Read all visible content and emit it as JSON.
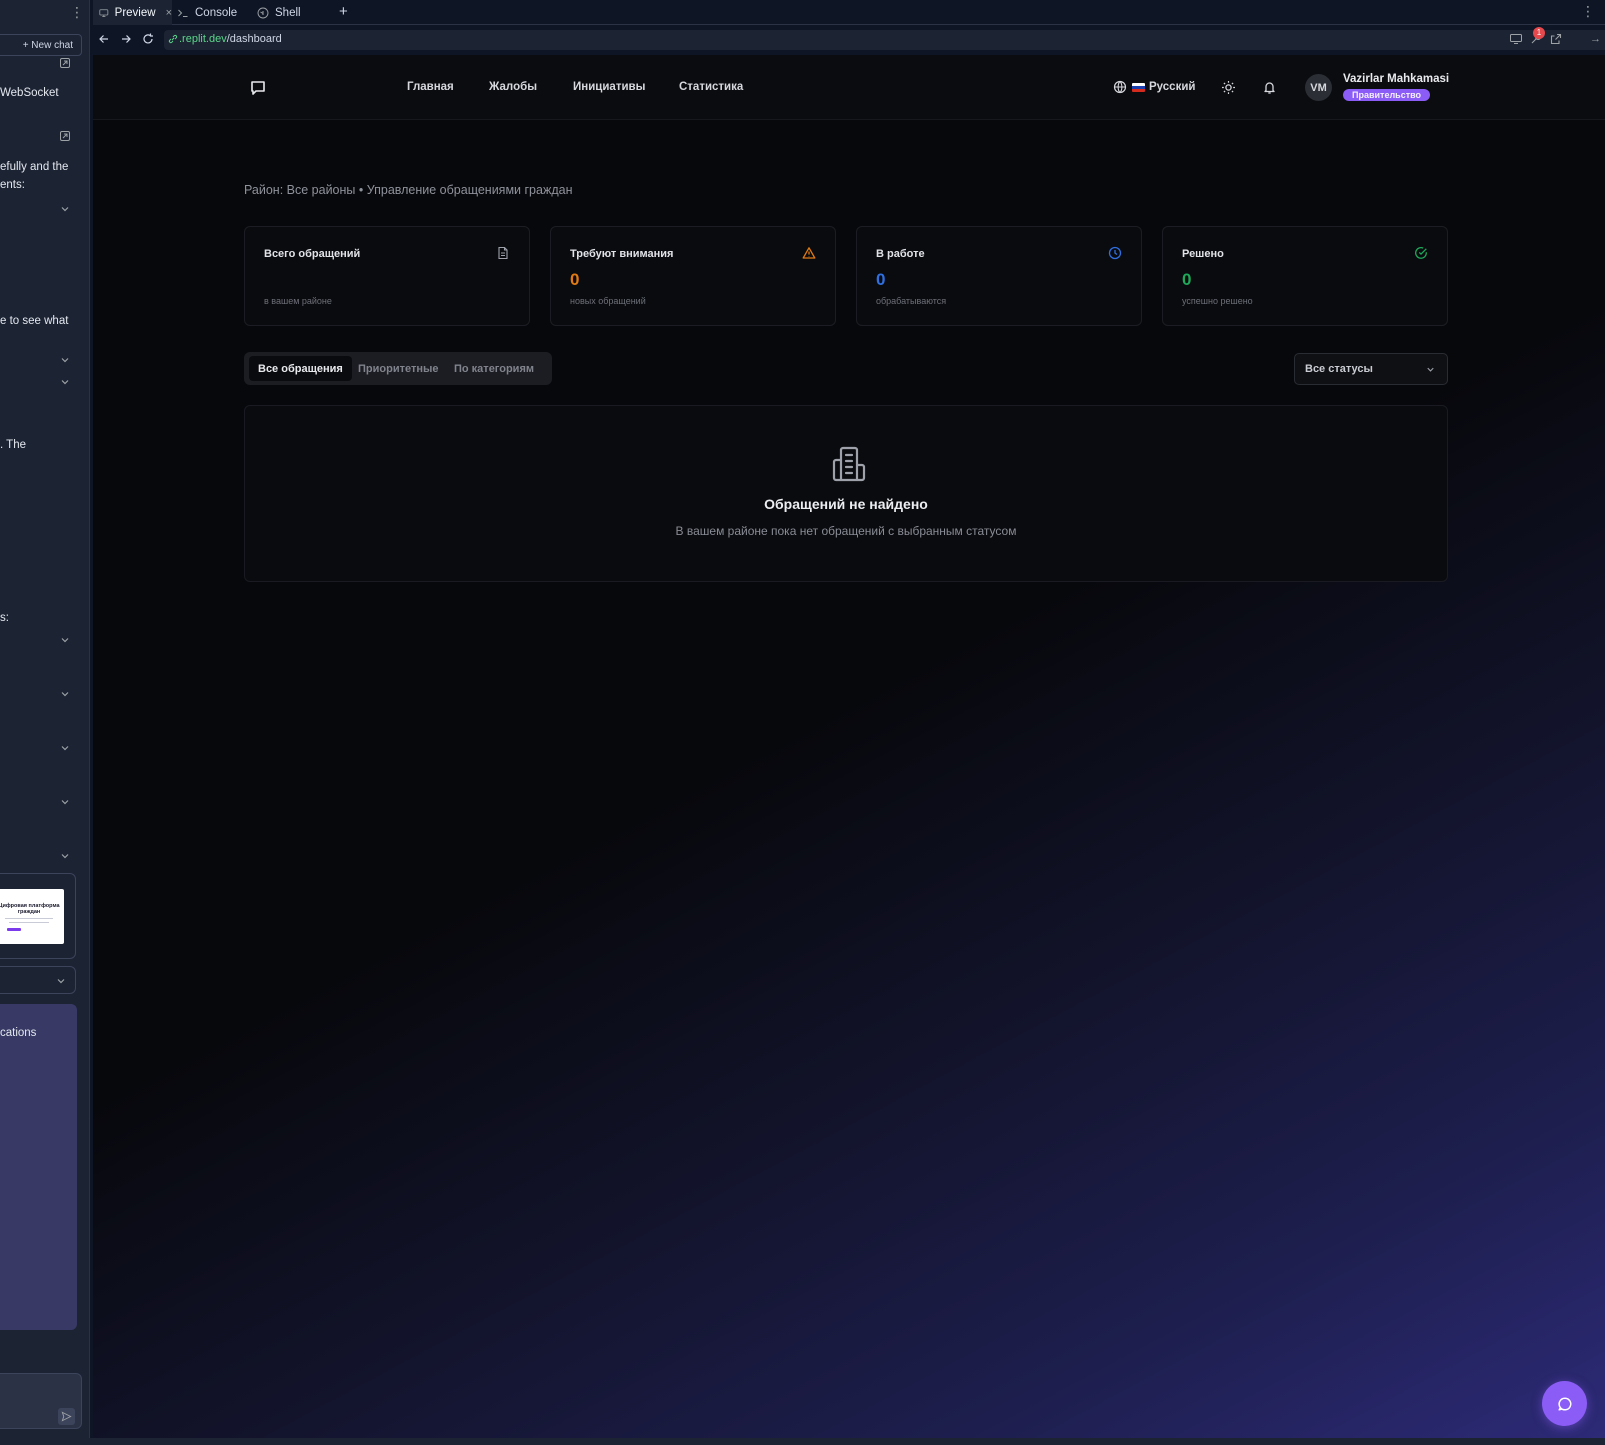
{
  "sidebar": {
    "new_chat_label": "+ New chat",
    "snippets": [
      "WebSocket",
      "efully and the",
      "ents:",
      "e to see what",
      ". The",
      "s:",
      "cations"
    ],
    "thumbnail_title": "Цифровая платформа граждан"
  },
  "ide_tabs": [
    {
      "label": "Preview",
      "active": true,
      "icon": "monitor-icon"
    },
    {
      "label": "Console",
      "active": false,
      "icon": "terminal-icon"
    },
    {
      "label": "Shell",
      "active": false,
      "icon": "shell-icon"
    }
  ],
  "urlbar": {
    "host": ".replit.dev",
    "path": "/dashboard",
    "notification_count": "1"
  },
  "app": {
    "nav": [
      "Главная",
      "Жалобы",
      "Инициативы",
      "Статистика"
    ],
    "language": "Русский",
    "user": {
      "initials": "VM",
      "name": "Vazirlar Mahkamasi",
      "role": "Правительство"
    },
    "subtitle": "Район: Все районы • Управление обращениями граждан",
    "stats": [
      {
        "label": "Всего обращений",
        "value": "",
        "desc": "в вашем районе",
        "icon": "document-icon",
        "color": "#9ea1aa"
      },
      {
        "label": "Требуют внимания",
        "value": "0",
        "desc": "новых обращений",
        "icon": "warning-icon",
        "color": "#e07a14"
      },
      {
        "label": "В работе",
        "value": "0",
        "desc": "обрабатываются",
        "icon": "clock-icon",
        "color": "#2f6fe0"
      },
      {
        "label": "Решено",
        "value": "0",
        "desc": "успешно решено",
        "icon": "check-circle-icon",
        "color": "#1fa85a"
      }
    ],
    "tabs": [
      "Все обращения",
      "Приоритетные",
      "По категориям"
    ],
    "status_filter": "Все статусы",
    "empty": {
      "title": "Обращений не найдено",
      "message": "В вашем районе пока нет обращений с выбранным статусом"
    }
  }
}
